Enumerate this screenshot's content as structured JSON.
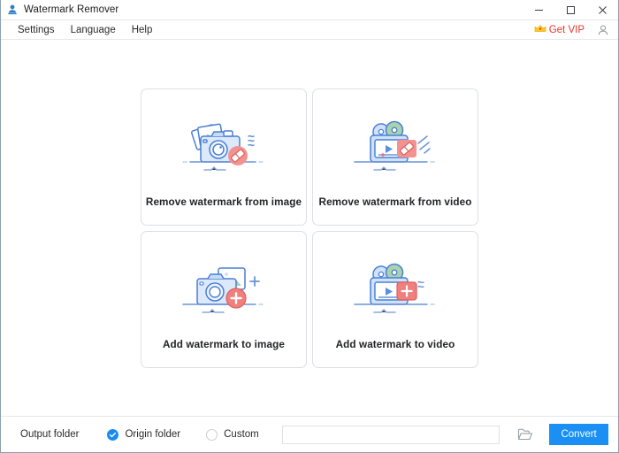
{
  "window": {
    "title": "Watermark Remover",
    "app_icon": "user-stamp-icon",
    "controls": {
      "minimize": "minimize-icon",
      "maximize": "maximize-icon",
      "close": "close-icon"
    }
  },
  "menubar": {
    "items": [
      {
        "label": "Settings"
      },
      {
        "label": "Language"
      },
      {
        "label": "Help"
      }
    ],
    "vip": {
      "label": "Get VIP",
      "icon": "crown-icon",
      "color": "#e8372a"
    },
    "account_icon": "account-person-icon"
  },
  "main": {
    "cards": [
      {
        "id": "remove-watermark-from-image",
        "title": "Remove watermark from image",
        "art": "camera-photo-eraser-icon"
      },
      {
        "id": "remove-watermark-from-video",
        "title": "Remove watermark from video",
        "art": "video-player-eraser-icon"
      },
      {
        "id": "add-watermark-to-image",
        "title": "Add watermark to image",
        "art": "camera-photo-plus-icon"
      },
      {
        "id": "add-watermark-to-video",
        "title": "Add watermark to video",
        "art": "video-player-plus-icon"
      }
    ]
  },
  "bottombar": {
    "output_label": "Output folder",
    "options": [
      {
        "label": "Origin folder",
        "selected": true
      },
      {
        "label": "Custom",
        "selected": false
      }
    ],
    "path_value": "",
    "path_placeholder": "",
    "browse_icon": "folder-open-icon",
    "convert_label": "Convert",
    "convert_color": "#1a90f5"
  }
}
